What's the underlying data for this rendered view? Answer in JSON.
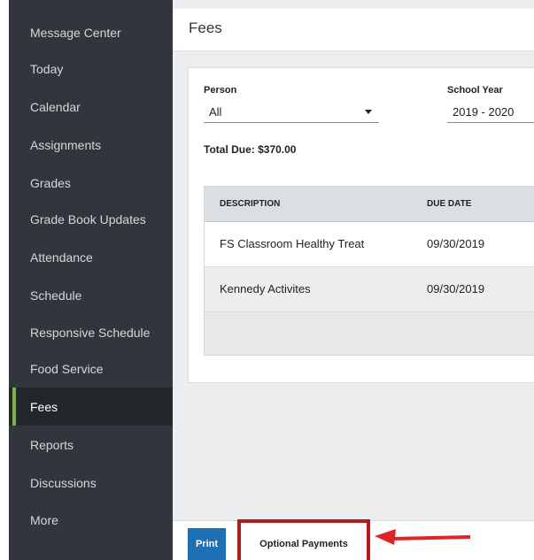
{
  "sidebar": {
    "items": [
      {
        "label": "Message Center",
        "active": false
      },
      {
        "label": "Today",
        "active": false
      },
      {
        "label": "Calendar",
        "active": false
      },
      {
        "label": "Assignments",
        "active": false
      },
      {
        "label": "Grades",
        "active": false
      },
      {
        "label": "Grade Book Updates",
        "active": false
      },
      {
        "label": "Attendance",
        "active": false
      },
      {
        "label": "Schedule",
        "active": false
      },
      {
        "label": "Responsive Schedule",
        "active": false
      },
      {
        "label": "Food Service",
        "active": false
      },
      {
        "label": "Fees",
        "active": true
      },
      {
        "label": "Reports",
        "active": false
      },
      {
        "label": "Discussions",
        "active": false
      },
      {
        "label": "More",
        "active": false
      }
    ]
  },
  "header": {
    "title": "Fees"
  },
  "filters": {
    "person_label": "Person",
    "person_value": "All",
    "school_year_label": "School Year",
    "school_year_value": "2019 - 2020"
  },
  "total_due": "Total Due: $370.00",
  "table": {
    "columns": [
      "DESCRIPTION",
      "DUE DATE"
    ],
    "rows": [
      [
        "FS Classroom Healthy Treat",
        "09/30/2019"
      ],
      [
        "Kennedy Activites",
        "09/30/2019"
      ]
    ]
  },
  "footer": {
    "print_label": "Print",
    "optional_payments_label": "Optional Payments"
  },
  "colors": {
    "sidebar_bg": "#30363b",
    "active_accent": "#7cb342",
    "primary_button": "#1f6fb5",
    "highlight_red": "#b01c1c",
    "arrow_red": "#e02424"
  },
  "icons": [
    "dropdown-caret-icon",
    "annotation-arrow-icon"
  ]
}
